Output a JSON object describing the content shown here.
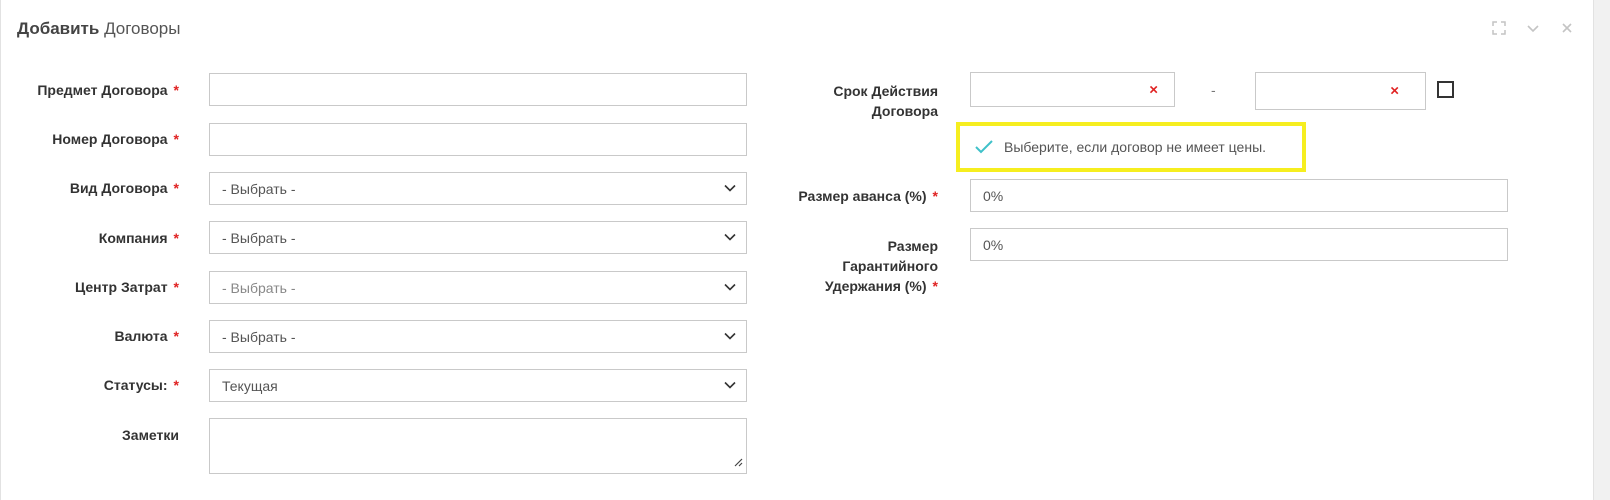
{
  "header": {
    "title_bold": "Добавить",
    "title_rest": " Договоры",
    "icons": [
      "fullscreen-icon",
      "chevron-down-icon",
      "close-icon"
    ]
  },
  "form": {
    "subject": {
      "label": "Предмет Договора",
      "value": ""
    },
    "number": {
      "label": "Номер Договора",
      "value": ""
    },
    "type": {
      "label": "Вид Договора",
      "value": "- Выбрать -"
    },
    "company": {
      "label": "Компания",
      "value": "- Выбрать -"
    },
    "cost_center": {
      "label": "Центр Затрат",
      "value": "- Выбрать -"
    },
    "currency": {
      "label": "Валюта",
      "value": "- Выбрать -"
    },
    "status": {
      "label": "Статусы:",
      "value": "Текущая"
    },
    "notes": {
      "label": "Заметки",
      "value": ""
    },
    "term": {
      "label_line1": "Срок Действия",
      "label_line2": "Договора",
      "start_value": "",
      "end_value": "",
      "separator": "-",
      "clear_symbol": "×"
    },
    "no_price_hint": "Выберите, если договор не имеет цены.",
    "advance": {
      "label": "Размер аванса (%)",
      "value": "0%"
    },
    "retention": {
      "label_line1": "Размер",
      "label_line2": "Гарантийного",
      "label_line3": "Удержания (%)",
      "value": "0%"
    },
    "required_mark": "*"
  },
  "colors": {
    "required": "#e02222",
    "highlight": "#f6ee1f",
    "check": "#3fc1c9"
  }
}
